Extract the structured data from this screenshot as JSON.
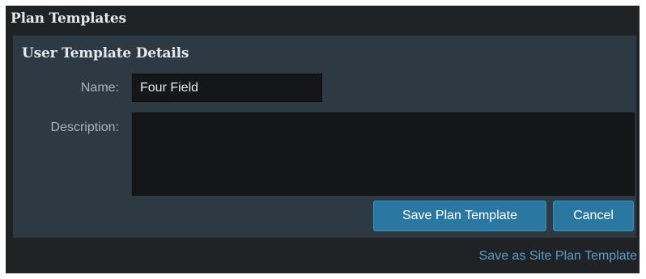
{
  "window": {
    "title": "Plan Templates"
  },
  "details_panel": {
    "title": "User Template Details",
    "name_label": "Name:",
    "name_value": "Four Field",
    "description_label": "Description:",
    "description_value": ""
  },
  "actions": {
    "save_label": "Save Plan Template",
    "cancel_label": "Cancel",
    "save_site_label": "Save as Site Plan Template"
  },
  "colors": {
    "window_bg": "#202326",
    "panel_bg": "#2d3a44",
    "input_bg": "#141618",
    "button_bg": "#2a78a2",
    "link": "#5d9cc8"
  }
}
